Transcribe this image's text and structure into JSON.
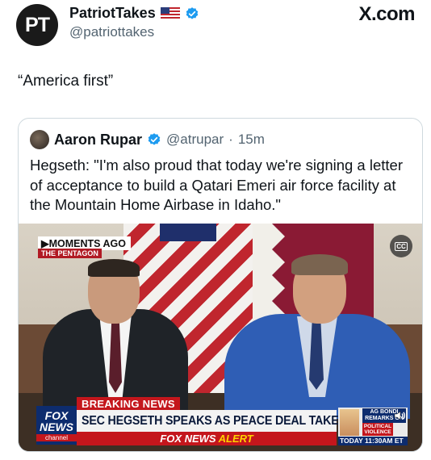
{
  "author": {
    "avatar_text": "PT",
    "display_name": "PatriotTakes",
    "handle": "@patriottakes"
  },
  "watermark": "X.com",
  "post": {
    "text": "“America first”"
  },
  "quote": {
    "name": "Aaron Rupar",
    "handle": "@atrupar",
    "separator": "·",
    "time": "15m",
    "text": "Hegseth: \"I'm also proud that today we're signing a letter of acceptance to build a Qatari Emeri air force facility at the Mountain Home Airbase in Idaho.\""
  },
  "video": {
    "moments_label": "▶MOMENTS AGO",
    "location_label": "THE PENTAGON",
    "cc_label": "CC",
    "breaking_label": "BREAKING NEWS",
    "headline": "SEC HEGSETH SPEAKS AS PEACE DEAL TAKES HOLD",
    "alert_brand": "FOX NEWS",
    "alert_word": "ALERT",
    "logo_line1": "FOX",
    "logo_line2": "NEWS",
    "logo_line3": "channel",
    "side_label": "AG BONDI REMARKS ON",
    "side_tag": "POLITICAL VIOLENCE",
    "side_time": "TODAY 11:30AM ET"
  }
}
